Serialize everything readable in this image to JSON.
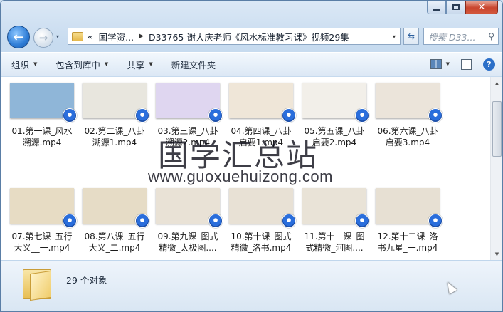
{
  "window": {
    "minimize_glyph": "",
    "maximize_glyph": "",
    "close_glyph": "✕"
  },
  "nav": {
    "back_glyph": "←",
    "forward_glyph": "→",
    "history_glyph": "▾"
  },
  "address": {
    "overflow": "«",
    "crumbs": [
      "国学资...",
      "D33765 谢大庆老师《风水标准教习课》视频29集"
    ],
    "dropdown_glyph": "▾"
  },
  "search": {
    "placeholder": "搜索 D33...",
    "icon": "search-icon"
  },
  "toolbar": {
    "organize": "组织",
    "include_in_library": "包含到库中",
    "share": "共享",
    "new_folder": "新建文件夹"
  },
  "files": [
    {
      "line1": "01.第一课_风水",
      "line2": "溯源.mp4",
      "thumb_color": "#8fb6d8"
    },
    {
      "line1": "02.第二课_八卦",
      "line2": "溯源1.mp4",
      "thumb_color": "#e8e6de"
    },
    {
      "line1": "03.第三课_八卦",
      "line2": "溯源2.mp4",
      "thumb_color": "#dfd6f0"
    },
    {
      "line1": "04.第四课_八卦",
      "line2": "启要1.mp4",
      "thumb_color": "#efe6d8"
    },
    {
      "line1": "05.第五课_八卦",
      "line2": "启要2.mp4",
      "thumb_color": "#f2efe9"
    },
    {
      "line1": "06.第六课_八卦",
      "line2": "启要3.mp4",
      "thumb_color": "#ebe4da"
    },
    {
      "line1": "07.第七课_五行",
      "line2": "大义__一.mp4",
      "thumb_color": "#e7dcc4"
    },
    {
      "line1": "08.第八课_五行",
      "line2": "大义_二.mp4",
      "thumb_color": "#e6dcc6"
    },
    {
      "line1": "09.第九课_图式",
      "line2": "精微_太极图....",
      "thumb_color": "#e9e2d6"
    },
    {
      "line1": "10.第十课_图式",
      "line2": "精微_洛书.mp4",
      "thumb_color": "#e8e1d5"
    },
    {
      "line1": "11.第十一课_图",
      "line2": "式精微_河图....",
      "thumb_color": "#e9e3d7"
    },
    {
      "line1": "12.第十二课_洛",
      "line2": "书九星_一.mp4",
      "thumb_color": "#e7e0d3"
    }
  ],
  "watermark": {
    "title": "国学汇总站",
    "url": "www.guoxuehuizong.com"
  },
  "details": {
    "count": "29 个对象"
  },
  "scrollbar": {
    "up": "▲",
    "down": "▼"
  }
}
